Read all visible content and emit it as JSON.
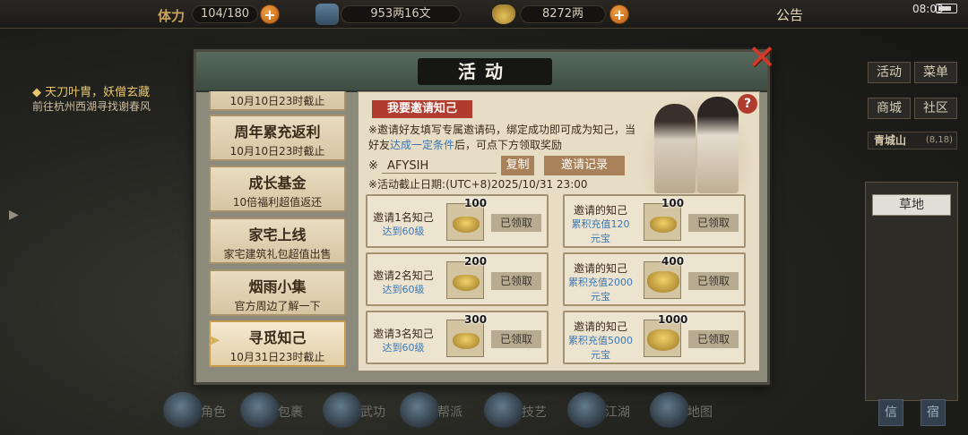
{
  "topbar": {
    "stamina_label": "体力",
    "stamina_value": "104/180",
    "silver_value": "953两16文",
    "ingot_value": "8272两",
    "notice_label": "公告",
    "clock": "08:03"
  },
  "quest": {
    "title": "◆ 天刀叶胄，妖僧玄藏",
    "desc": "前往杭州西湖寻找谢春风"
  },
  "right_panel": {
    "btn_activity": "活动",
    "btn_menu": "菜单",
    "btn_shop": "商城",
    "btn_community": "社区",
    "location_name": "青城山",
    "location_coords": "(8,18)",
    "terrain": "草地",
    "btn_mail": "信",
    "btn_corner": "宿"
  },
  "bottom_bar": [
    {
      "label": "角色"
    },
    {
      "label": "包裹"
    },
    {
      "label": "武功"
    },
    {
      "label": "帮派"
    },
    {
      "label": "技艺"
    },
    {
      "label": "江湖"
    },
    {
      "label": "地图"
    }
  ],
  "dialog": {
    "title": "活动",
    "close_icon": "close-x-icon",
    "menu": [
      {
        "title": "",
        "sub": "10月10日23时截止"
      },
      {
        "title": "周年累充返利",
        "sub": "10月10日23时截止"
      },
      {
        "title": "成长基金",
        "sub": "10倍福利超值返还"
      },
      {
        "title": "家宅上线",
        "sub": "家宅建筑礼包超值出售"
      },
      {
        "title": "烟雨小集",
        "sub": "官方周边了解一下"
      },
      {
        "title": "寻觅知己",
        "sub": "10月31日23时截止"
      }
    ],
    "content": {
      "section_tag": "我要邀请知己",
      "intro_part1": "※邀请好友填写专属邀请码，绑定成功即可成为知己，当好友",
      "intro_highlight": "达成一定条件",
      "intro_part2": "后，可点下方领取奖励",
      "code_prefix": "※",
      "invite_code": "AFYSIH",
      "copy_button": "复制",
      "record_button": "邀请记录",
      "deadline": "※活动截止日期:(UTC+8)2025/10/31 23:00",
      "help_icon": "?",
      "rewards_left": [
        {
          "line1": "邀请1名知己",
          "line2": "达到60级",
          "qty": "100",
          "status": "已领取"
        },
        {
          "line1": "邀请2名知己",
          "line2": "达到60级",
          "qty": "200",
          "status": "已领取"
        },
        {
          "line1": "邀请3名知己",
          "line2": "达到60级",
          "qty": "300",
          "status": "已领取"
        }
      ],
      "rewards_right": [
        {
          "line1": "邀请的知己",
          "line2": "累积充值120",
          "line3": "元宝",
          "qty": "100",
          "status": "已领取"
        },
        {
          "line1": "邀请的知己",
          "line2": "累积充值2000",
          "line3": "元宝",
          "qty": "400",
          "status": "已领取"
        },
        {
          "line1": "邀请的知己",
          "line2": "累积充值5000",
          "line3": "元宝",
          "qty": "1000",
          "status": "已领取"
        }
      ]
    }
  }
}
